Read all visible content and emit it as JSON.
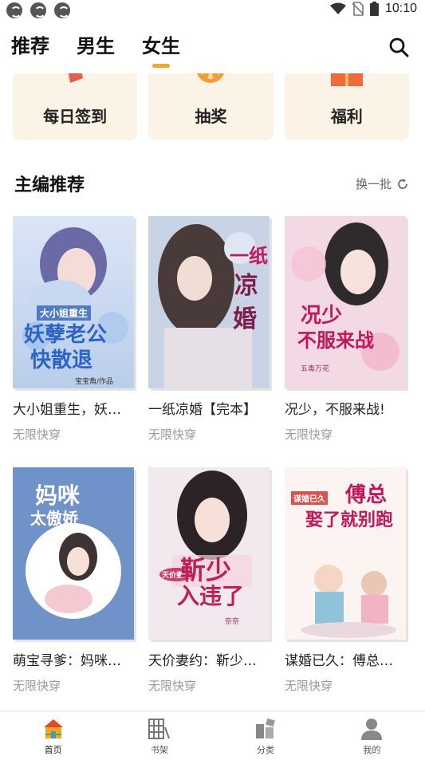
{
  "status_bar": {
    "time": "10:10",
    "left_icons": [
      "app-notification-icon",
      "app-notification-icon",
      "app-notification-icon"
    ],
    "right_icons": [
      "wifi-icon",
      "no-sim-icon",
      "battery-icon"
    ]
  },
  "top_tabs": [
    {
      "label": "推荐",
      "active": false
    },
    {
      "label": "男生",
      "active": false
    },
    {
      "label": "女生",
      "active": true
    }
  ],
  "accent_color": "#f5a623",
  "quick_actions": [
    {
      "label": "每日签到",
      "icon": "calendar-icon"
    },
    {
      "label": "抽奖",
      "icon": "lottery-wheel-icon"
    },
    {
      "label": "福利",
      "icon": "gift-icon"
    }
  ],
  "section": {
    "title": "主编推荐",
    "refresh_label": "换一批"
  },
  "books": [
    {
      "title": "大小姐重生，妖…",
      "tag": "无限快穿",
      "cover_title": [
        "大小姐重生",
        "妖孽老公",
        "快散退"
      ],
      "cover_author": "宝宝角/作品"
    },
    {
      "title": "一纸凉婚【完本】",
      "tag": "无限快穿",
      "cover_title": [
        "一纸",
        "凉",
        "婚"
      ],
      "cover_author": ""
    },
    {
      "title": "况少，不服来战!",
      "tag": "无限快穿",
      "cover_title": [
        "况少",
        "不服来战"
      ],
      "cover_author": "五毒万花"
    },
    {
      "title": "萌宝寻爹：妈咪…",
      "tag": "无限快穿",
      "cover_title": [
        "妈咪",
        "太傲娇"
      ],
      "cover_author": ""
    },
    {
      "title": "天价妻约：靳少…",
      "tag": "无限快穿",
      "cover_title": [
        "天价妻约",
        "靳少",
        "入违了"
      ],
      "cover_author": "奈奈"
    },
    {
      "title": "谋婚已久：傅总…",
      "tag": "无限快穿",
      "cover_title": [
        "谋婚已久",
        "傅总",
        "娶了就别跑"
      ],
      "cover_author": ""
    }
  ],
  "bottom_nav": [
    {
      "label": "首页",
      "icon": "home-icon",
      "active": true
    },
    {
      "label": "书架",
      "icon": "bookshelf-icon",
      "active": false
    },
    {
      "label": "分类",
      "icon": "category-icon",
      "active": false
    },
    {
      "label": "我的",
      "icon": "profile-icon",
      "active": false
    }
  ]
}
